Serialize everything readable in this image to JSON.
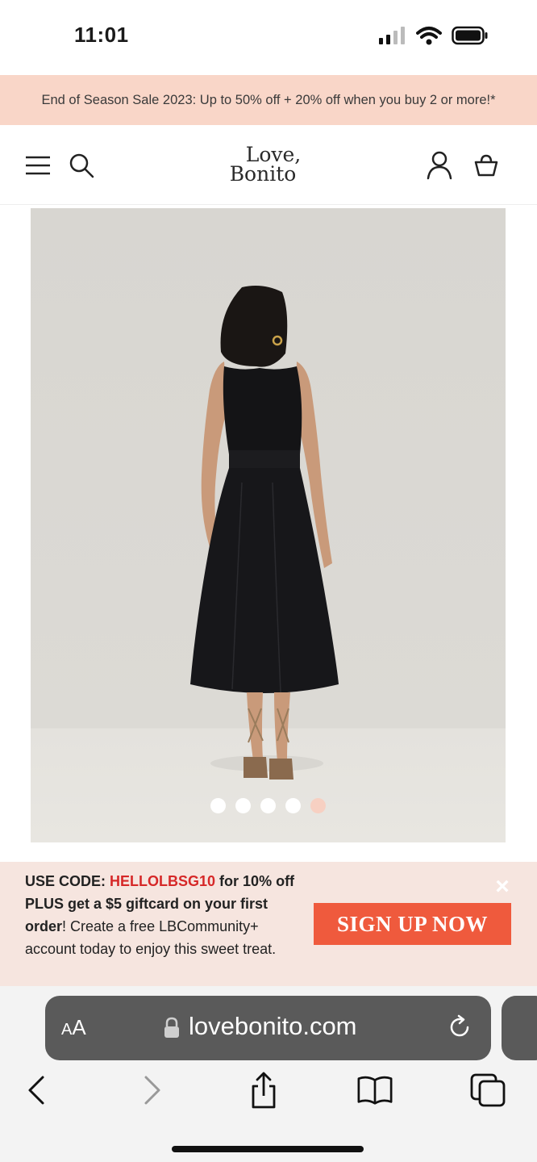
{
  "status_bar": {
    "time": "11:01",
    "icons": [
      "signal-icon",
      "wifi-icon",
      "battery-icon"
    ]
  },
  "promo": {
    "text": "End of Season Sale 2023: Up to 50% off + 20% off when you buy 2 or more!*"
  },
  "header": {
    "logo_line1": "Love,",
    "logo_line2": "Bonito",
    "icons": [
      "menu-icon",
      "search-icon",
      "account-icon",
      "cart-icon"
    ]
  },
  "product": {
    "image_description": "model-back-view-black-dress",
    "carousel": {
      "count": 5,
      "active_index": 4
    }
  },
  "signup": {
    "prefix": "USE CODE: ",
    "code": "HELLOLBSG10",
    "bold_part": " for 10% off PLUS get a $5 giftcard on your first order",
    "rest": "! Create a free LBCommunity+ account today to enjoy this sweet treat.",
    "button_label": "SIGN UP NOW",
    "close_label": "×"
  },
  "browser": {
    "aa_label_big": "A",
    "aa_label_small": "A",
    "domain": "lovebonito.com"
  },
  "colors": {
    "promo_bg": "#f9d6c8",
    "signup_bg": "#f6e5df",
    "signup_button": "#ef5a3d",
    "code_color": "#d62828",
    "image_bg": "#d6d4cf"
  }
}
